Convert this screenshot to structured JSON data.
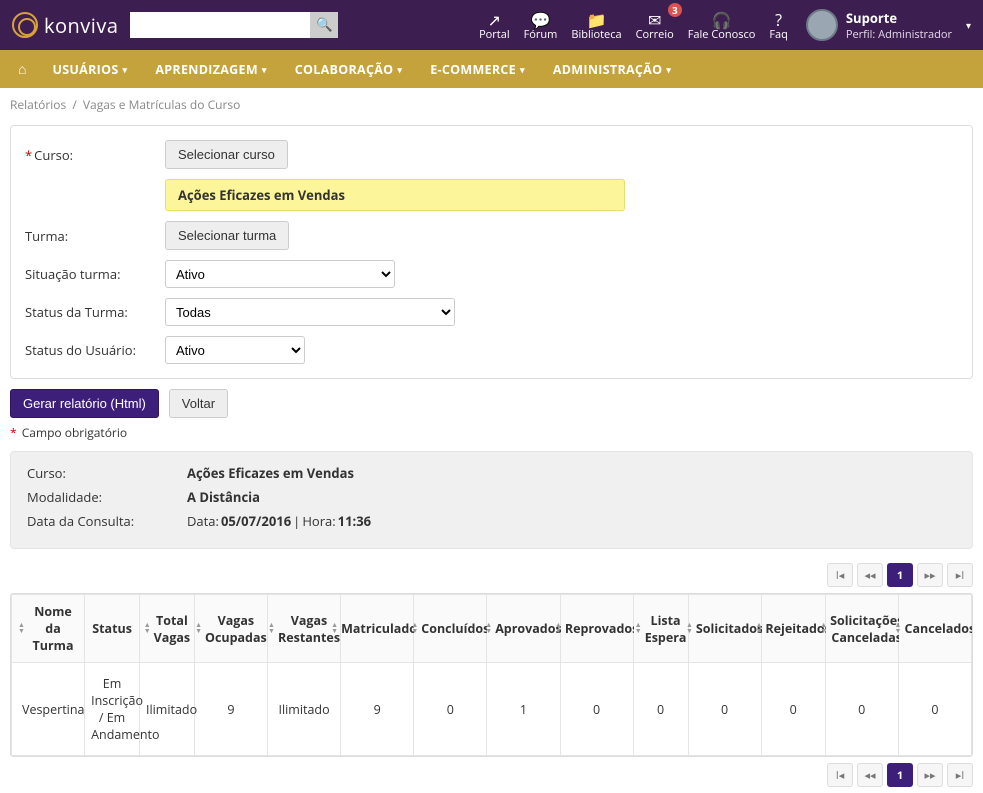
{
  "brand": "konviva",
  "topnav": [
    {
      "icon": "↗",
      "label": "Portal"
    },
    {
      "icon": "💬",
      "label": "Fórum"
    },
    {
      "icon": "📁",
      "label": "Biblioteca"
    },
    {
      "icon": "✉",
      "label": "Correio",
      "badge": "3"
    },
    {
      "icon": "🎧",
      "label": "Fale Conosco"
    },
    {
      "icon": "?",
      "label": "Faq"
    }
  ],
  "user": {
    "name": "Suporte",
    "role": "Perfil: Administrador"
  },
  "menu": [
    "USUÁRIOS",
    "APRENDIZAGEM",
    "COLABORAÇÃO",
    "E-COMMERCE",
    "ADMINISTRAÇÃO"
  ],
  "breadcrumb": {
    "root": "Relatórios",
    "page": "Vagas e Matrículas do Curso"
  },
  "form": {
    "curso_label": "Curso:",
    "selecionar_curso": "Selecionar curso",
    "curso_value": "Ações Eficazes em Vendas",
    "turma_label": "Turma:",
    "selecionar_turma": "Selecionar turma",
    "situacao_label": "Situação turma:",
    "situacao_value": "Ativo",
    "status_turma_label": "Status da Turma:",
    "status_turma_value": "Todas",
    "status_usuario_label": "Status do Usuário:",
    "status_usuario_value": "Ativo"
  },
  "buttons": {
    "gerar": "Gerar relatório (Html)",
    "voltar": "Voltar"
  },
  "required_note": "Campo obrigatório",
  "info": {
    "curso_label": "Curso:",
    "curso_value": "Ações Eficazes em Vendas",
    "modalidade_label": "Modalidade:",
    "modalidade_value": "A Distância",
    "data_consulta_label": "Data da Consulta:",
    "data_prefix": "Data:",
    "data_value": "05/07/2016",
    "hora_prefix": "Hora:",
    "hora_value": "11:36",
    "sep": " | "
  },
  "pagination_current": "1",
  "table": {
    "headers": [
      "Nome da Turma",
      "Status",
      "Total Vagas",
      "Vagas Ocupadas",
      "Vagas Restantes",
      "Matriculados",
      "Concluídos",
      "Aprovados",
      "Reprovados",
      "Lista Espera",
      "Solicitados",
      "Rejeitados",
      "Solicitações Canceladas",
      "Cancelados"
    ],
    "row": [
      "Vespertina",
      "Em Inscrição / Em Andamento",
      "Ilimitado",
      "9",
      "Ilimitado",
      "9",
      "0",
      "1",
      "0",
      "0",
      "0",
      "0",
      "0",
      "0"
    ]
  }
}
